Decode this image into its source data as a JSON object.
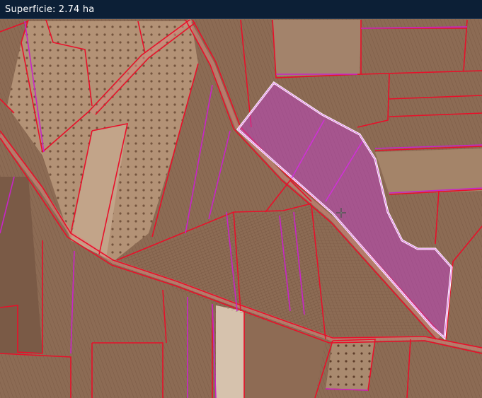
{
  "header": {
    "area_label": "Superficie:",
    "area_value": "2.74 ha"
  },
  "colors": {
    "header_bg": "#0c1f36",
    "boundary": "#e8102a",
    "subdivision": "#c825c8",
    "selection_fill": "#c040c8",
    "selection_outline": "#ffffff"
  },
  "map": {
    "cursor_icon": "crosshair-move-icon"
  }
}
